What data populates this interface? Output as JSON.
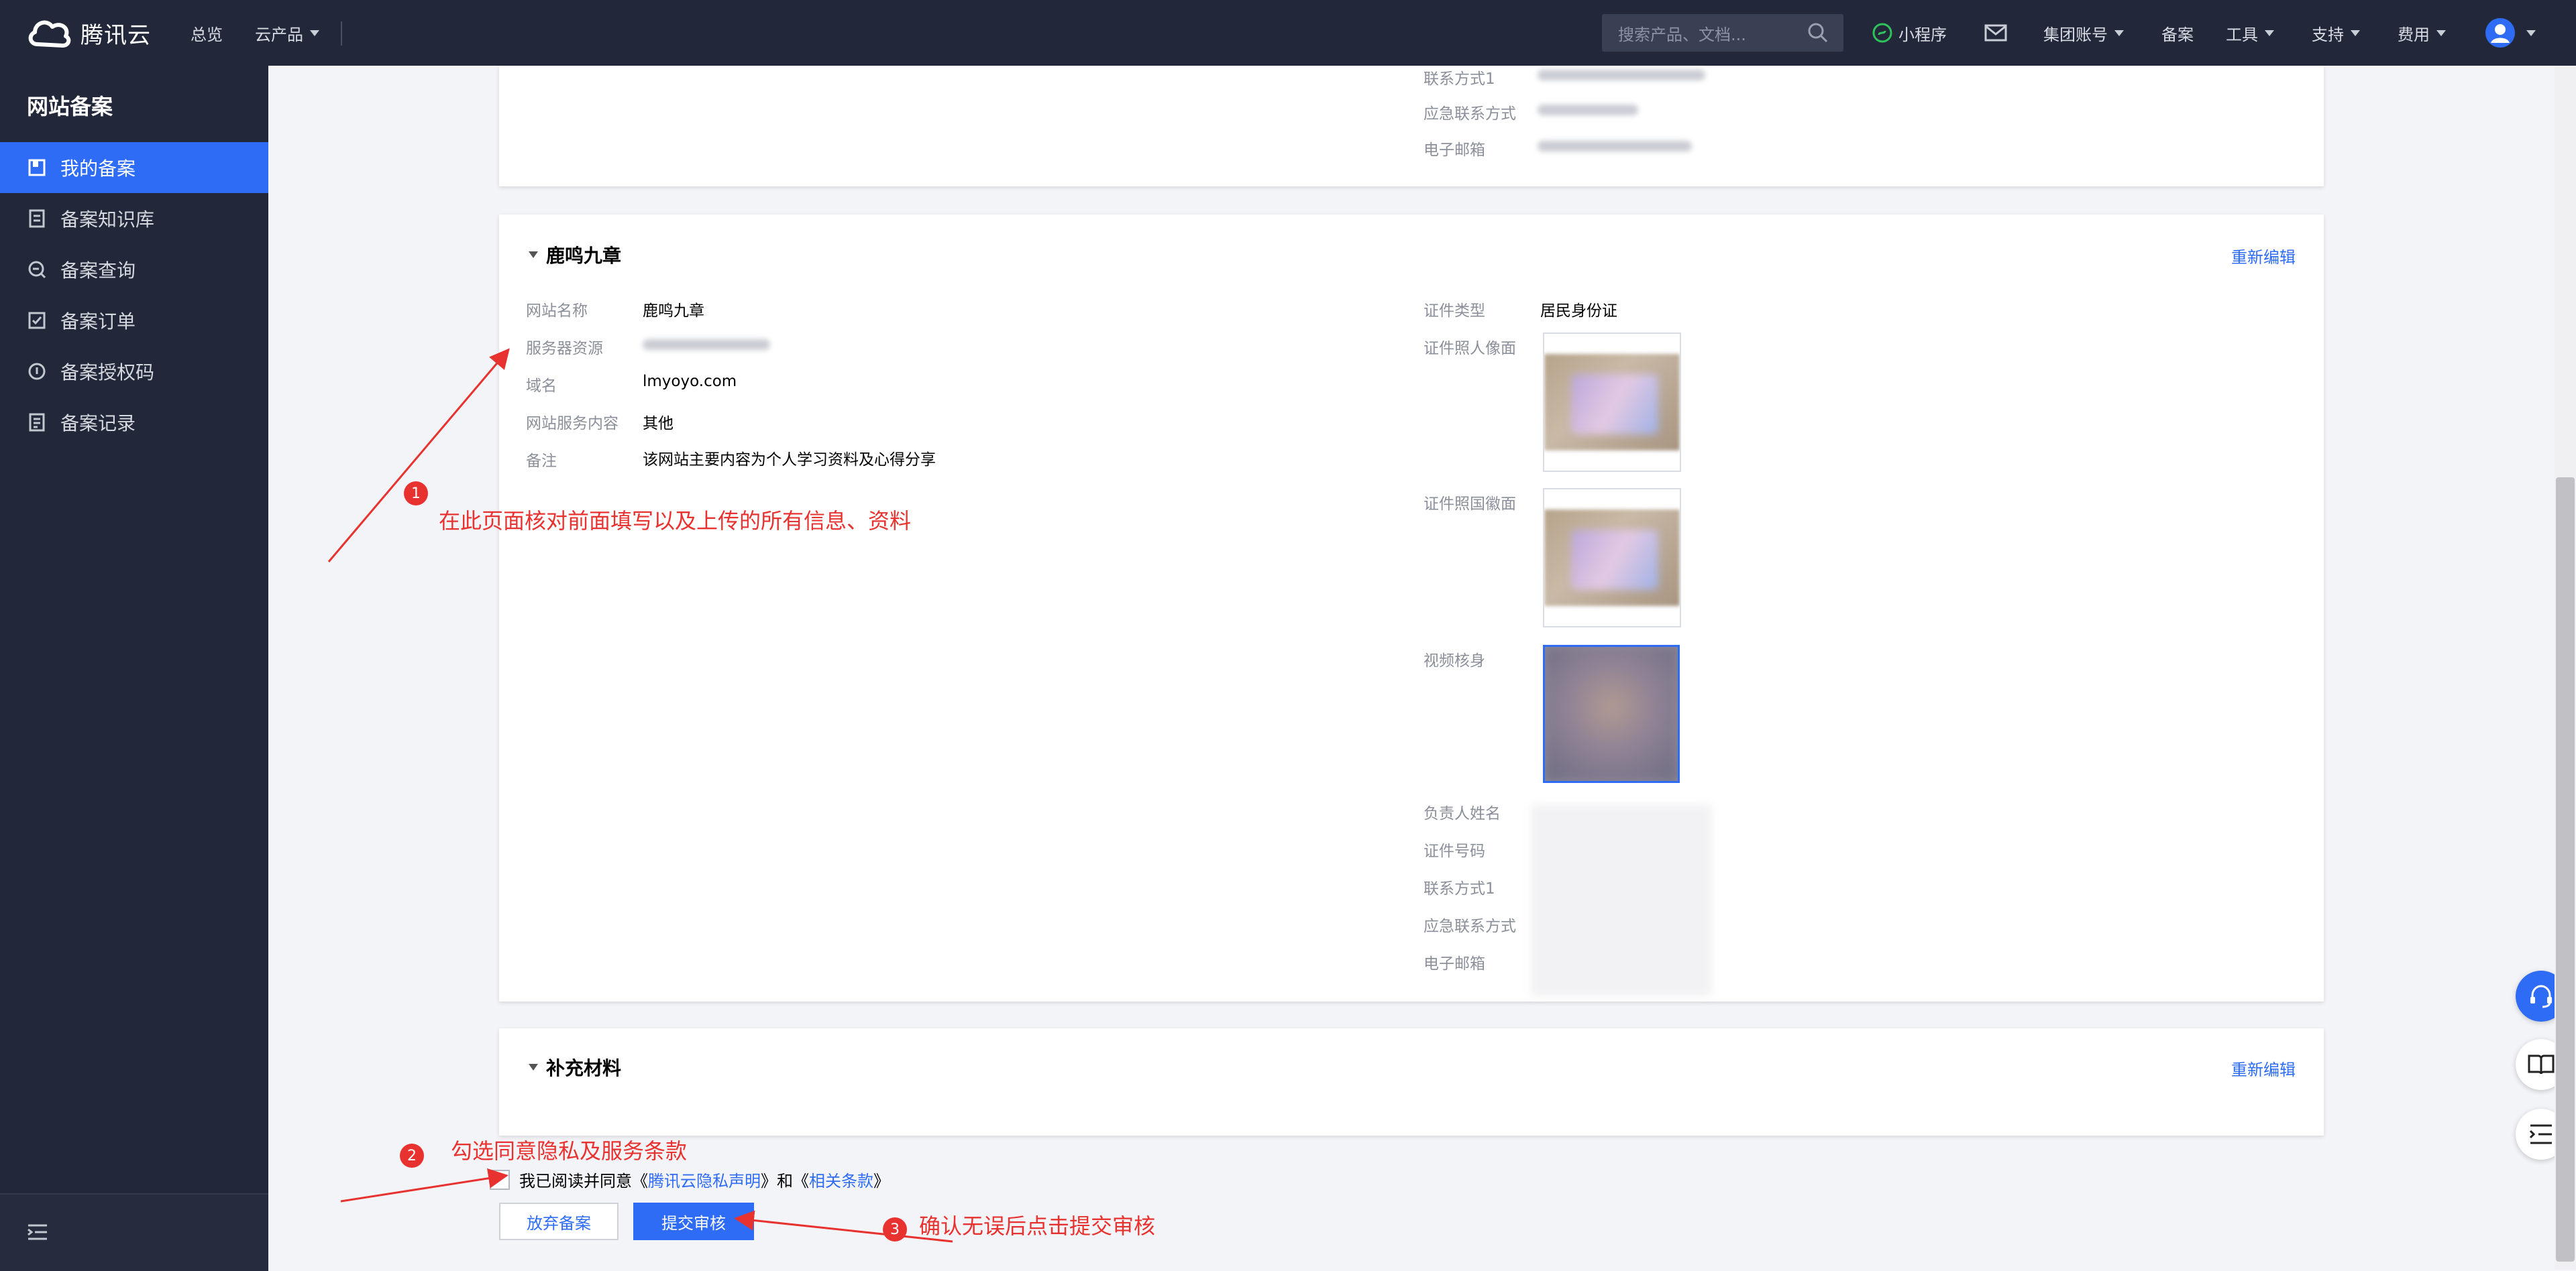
{
  "topbar": {
    "brand": "腾讯云",
    "nav": {
      "overview": "总览",
      "products": "云产品"
    },
    "search_placeholder": "搜索产品、文档...",
    "right": {
      "miniprogram": "小程序",
      "group_account": "集团账号",
      "filing": "备案",
      "tools": "工具",
      "support": "支持",
      "billing": "费用"
    }
  },
  "sidebar": {
    "title": "网站备案",
    "items": [
      {
        "label": "我的备案",
        "icon": "book-icon",
        "active": true
      },
      {
        "label": "备案知识库",
        "icon": "document-icon",
        "active": false
      },
      {
        "label": "备案查询",
        "icon": "search-doc-icon",
        "active": false
      },
      {
        "label": "备案订单",
        "icon": "checklist-icon",
        "active": false
      },
      {
        "label": "备案授权码",
        "icon": "auth-code-icon",
        "active": false
      },
      {
        "label": "备案记录",
        "icon": "record-icon",
        "active": false
      }
    ]
  },
  "top_card": {
    "labels": {
      "contact1": "联系方式1",
      "emergency": "应急联系方式",
      "email": "电子邮箱"
    }
  },
  "site_card": {
    "title": "鹿鸣九章",
    "reedit": "重新编辑",
    "left": {
      "site_name_label": "网站名称",
      "site_name": "鹿鸣九章",
      "server_label": "服务器资源",
      "domain_label": "域名",
      "domain": "lmyoyo.com",
      "service_label": "网站服务内容",
      "service": "其他",
      "remark_label": "备注",
      "remark": "该网站主要内容为个人学习资料及心得分享"
    },
    "right": {
      "id_type_label": "证件类型",
      "id_type": "居民身份证",
      "id_front_label": "证件照人像面",
      "id_back_label": "证件照国徽面",
      "video_label": "视频核身",
      "owner_label": "负责人姓名",
      "id_no_label": "证件号码",
      "contact1_label": "联系方式1",
      "emergency_label": "应急联系方式",
      "email_label": "电子邮箱"
    }
  },
  "supplement_card": {
    "title": "补充材料",
    "reedit": "重新编辑"
  },
  "agreement": {
    "prefix": "我已阅读并同意《",
    "privacy": "腾讯云隐私声明",
    "middle": "》和《",
    "terms": "相关条款",
    "suffix": "》",
    "checked": false
  },
  "buttons": {
    "abandon": "放弃备案",
    "submit": "提交审核"
  },
  "annotations": {
    "step1_num": "1",
    "step1_text": "在此页面核对前面填写以及上传的所有信息、资料",
    "step2_num": "2",
    "step2_text": "勾选同意隐私及服务条款",
    "step3_num": "3",
    "step3_text": "确认无误后点击提交审核",
    "color": "#e8322f"
  },
  "colors": {
    "accent": "#2e6cf6",
    "nav_bg": "#222839"
  }
}
